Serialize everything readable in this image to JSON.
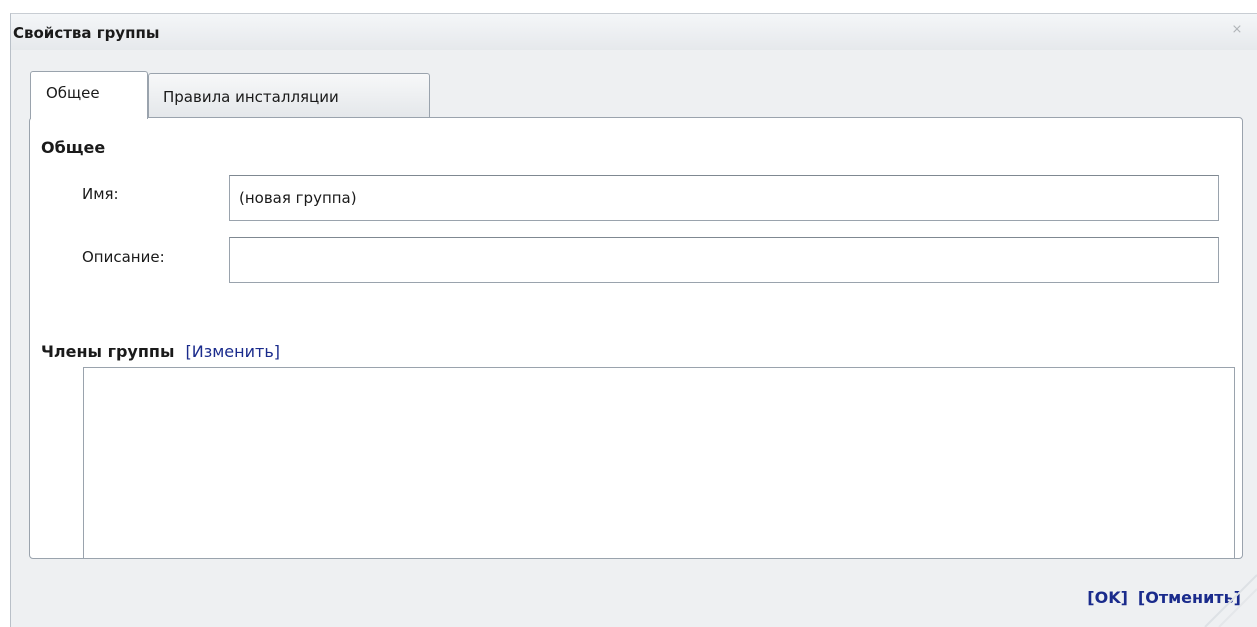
{
  "dialog": {
    "title": "Свойства группы",
    "close_glyph": "⨯"
  },
  "tabs": [
    {
      "label": "Общее",
      "active": true
    },
    {
      "label": "Правила инсталляции",
      "active": false
    }
  ],
  "general": {
    "section_title": "Общее",
    "name_label": "Имя:",
    "name_value": "(новая группа)",
    "description_label": "Описание:",
    "description_value": ""
  },
  "members": {
    "title": "Члены группы",
    "change_link": "[Изменить]",
    "items": []
  },
  "footer": {
    "ok_label": "[OK]",
    "cancel_label": "[Отменить]"
  },
  "colors": {
    "link": "#1a2b8c",
    "border": "#9aa3ad",
    "dialog_bg": "#eef0f2"
  }
}
